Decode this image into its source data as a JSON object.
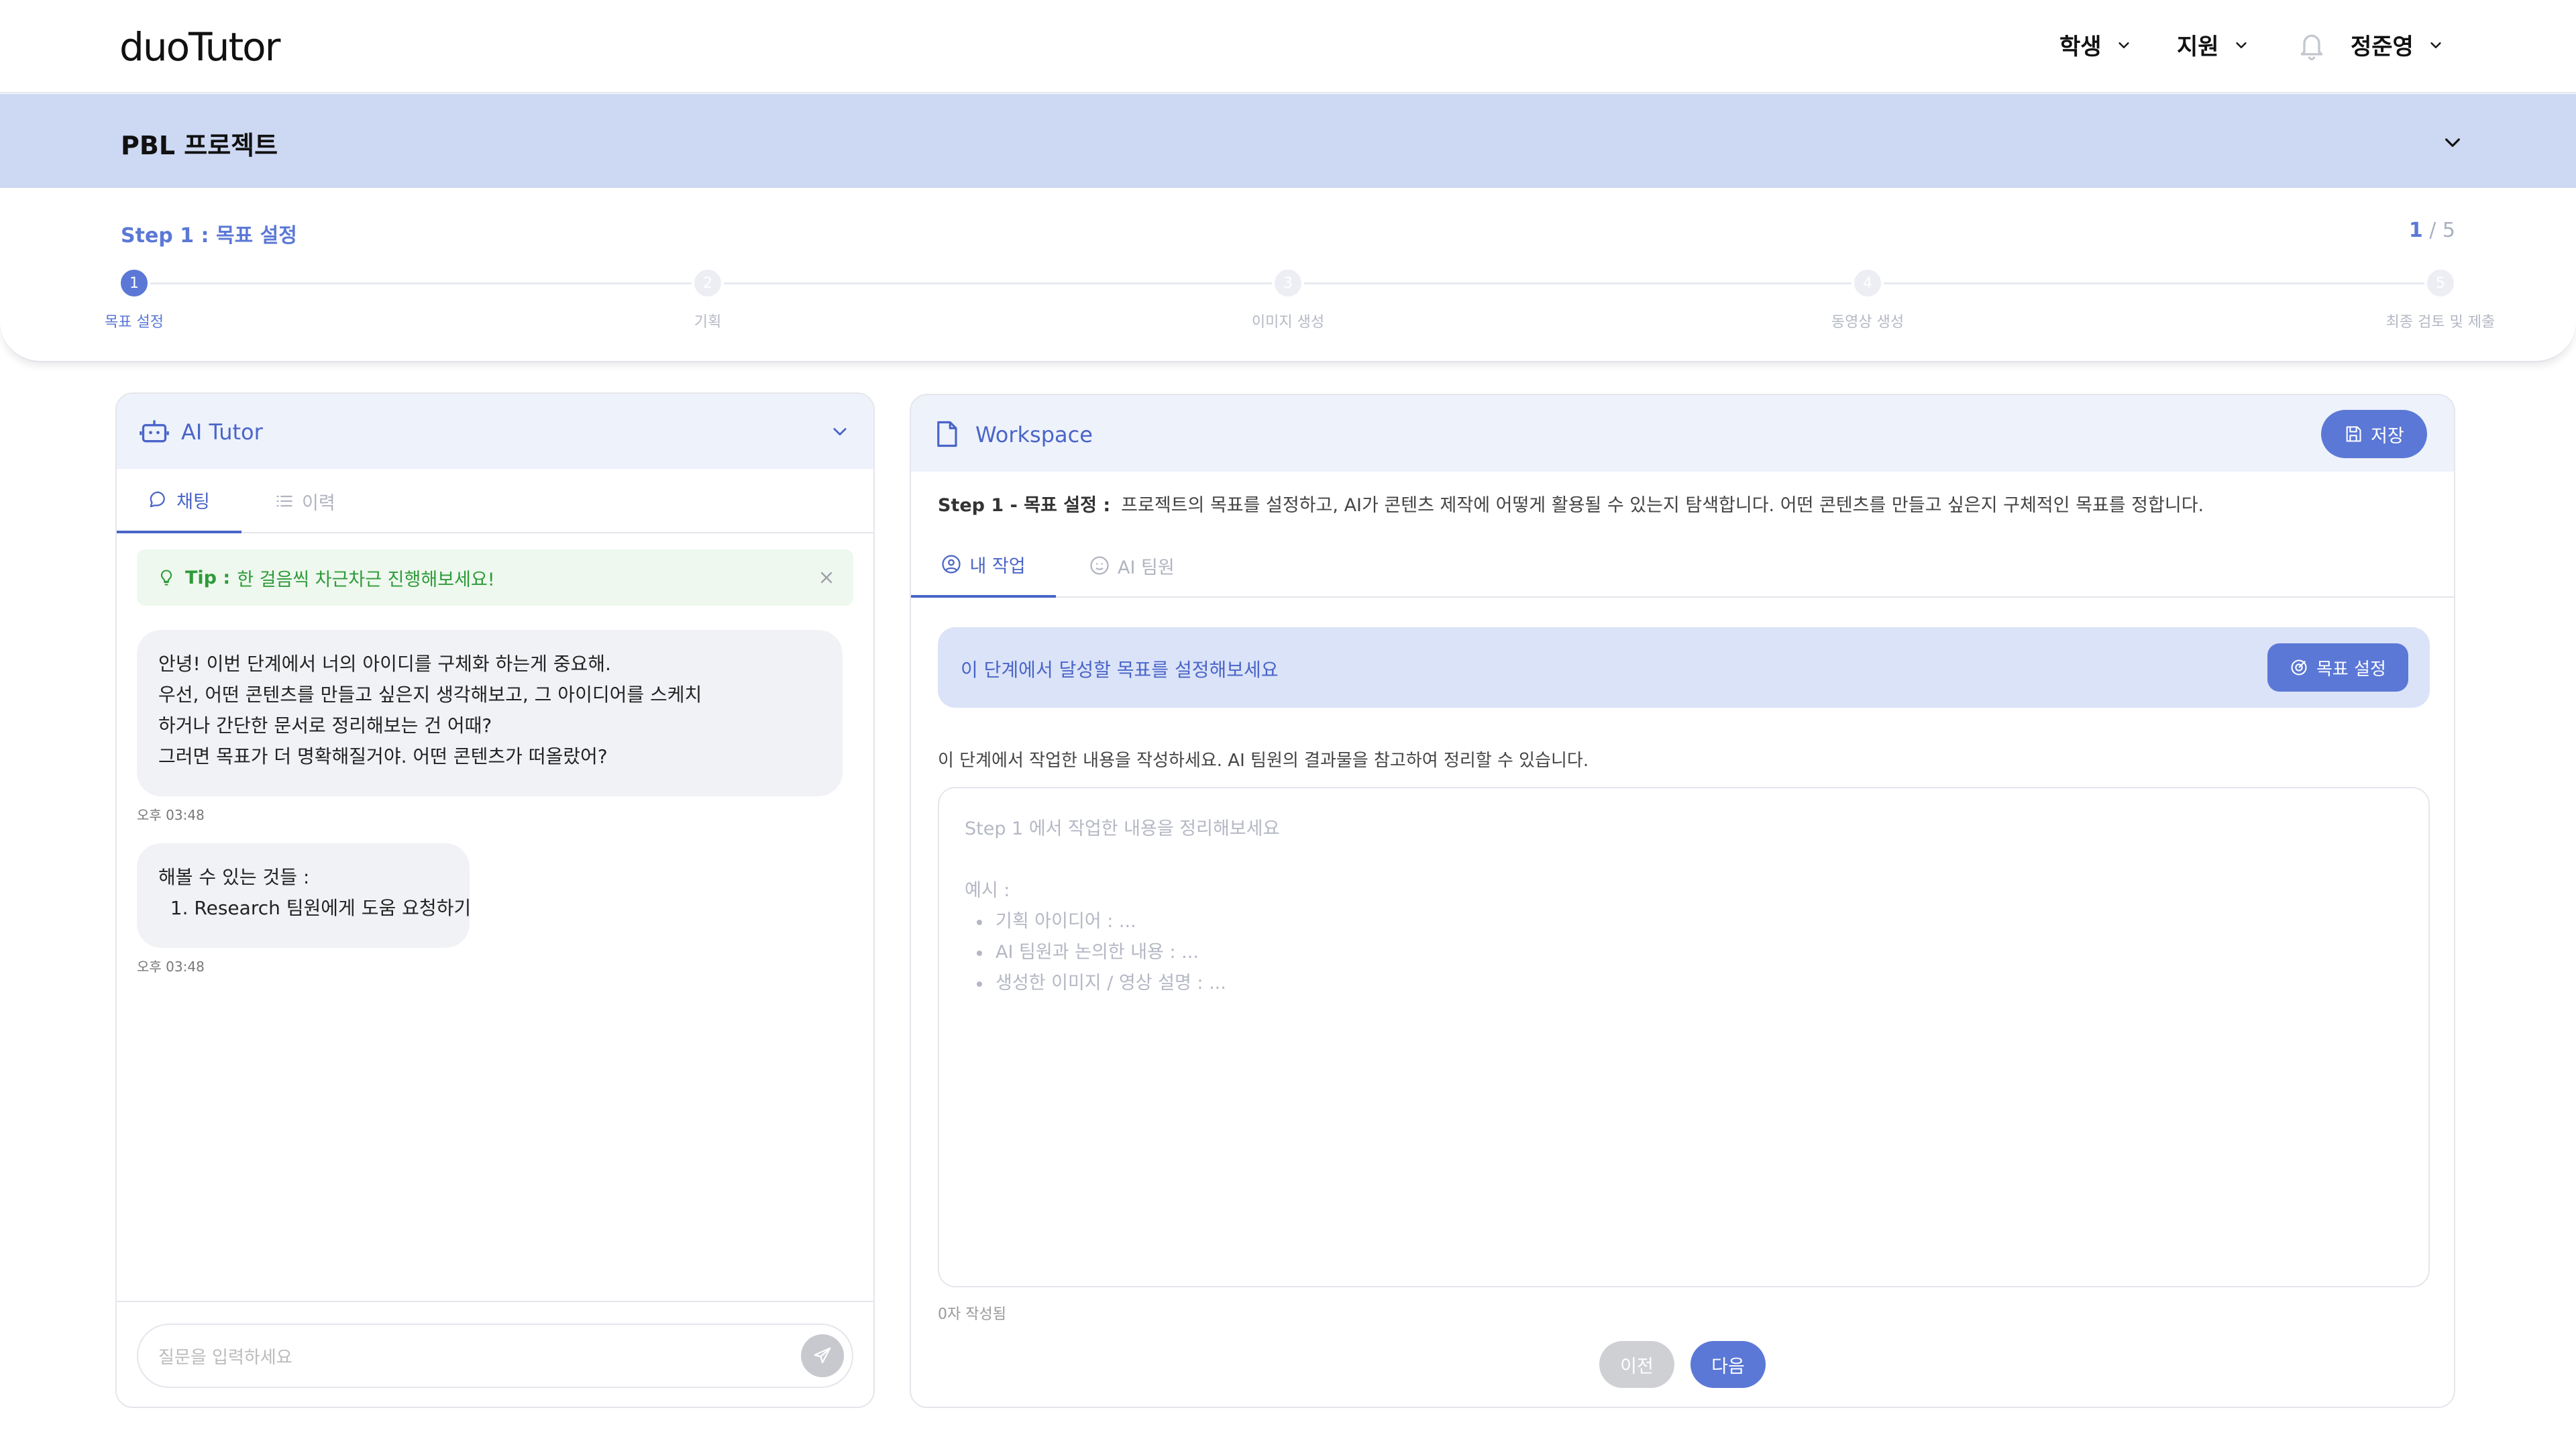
{
  "app": {
    "logo": "duoTutor"
  },
  "nav": {
    "student_label": "학생",
    "support_label": "지원",
    "user_name": "정준영"
  },
  "banner": {
    "title": "PBL 프로젝트"
  },
  "stepper": {
    "current_title": "Step 1 : 목표 설정",
    "current": "1",
    "separator": "/",
    "total": "5",
    "steps": [
      {
        "num": "1",
        "label": "목표 설정"
      },
      {
        "num": "2",
        "label": "기획"
      },
      {
        "num": "3",
        "label": "이미지 생성"
      },
      {
        "num": "4",
        "label": "동영상 생성"
      },
      {
        "num": "5",
        "label": "최종 검토 및 제출"
      }
    ]
  },
  "tutor": {
    "title": "AI Tutor",
    "tabs": [
      {
        "label": "채팅"
      },
      {
        "label": "이력"
      }
    ],
    "tip_label": "Tip :",
    "tip_text": "한 걸음씩 차근차근 진행해보세요!",
    "messages": [
      {
        "lines": [
          "안녕! 이번 단계에서 너의 아이디를 구체화 하는게 중요해.",
          "우선, 어떤 콘텐츠를 만들고 싶은지 생각해보고, 그 아이디어를 스케치",
          "하거나 간단한 문서로 정리해보는 건 어때?",
          "그러면 목표가 더 명확해질거야. 어떤 콘텐츠가 떠올랐어?"
        ],
        "time": "오후 03:48"
      },
      {
        "lines": [
          "해볼 수 있는 것들 :",
          "  1. Research 팀원에게 도움 요청하기"
        ],
        "time": "오후 03:48"
      }
    ],
    "input_placeholder": "질문을 입력하세요"
  },
  "workspace": {
    "title": "Workspace",
    "save_label": "저장",
    "desc_label": "Step 1 - 목표 설정 :",
    "desc_text": "프로젝트의 목표를 설정하고, AI가 콘텐츠 제작에 어떻게 활용될 수 있는지 탐색합니다. 어떤 콘텐츠를 만들고 싶은지 구체적인 목표를 정합니다.",
    "tabs": [
      {
        "label": "내 작업"
      },
      {
        "label": "AI 팀원"
      }
    ],
    "goal_prompt": "이 단계에서 달성할 목표를 설정해보세요",
    "goal_button": "목표 설정",
    "note": "이 단계에서 작업한 내용을 작성하세요. AI 팀원의 결과물을 참고하여 정리할 수 있습니다.",
    "textarea_placeholder": "Step 1 에서 작업한 내용을 정리해보세요",
    "example_label": "예시 :",
    "examples": [
      "기획 아이디어 : ...",
      "AI 팀원과 논의한 내용 : ...",
      "생성한 이미지 / 영상 설명 : ..."
    ],
    "char_count": "0자 작성됨",
    "prev_label": "이전",
    "next_label": "다음"
  },
  "colors": {
    "accent": "#5b78d6",
    "banner": "#cdd8f2",
    "panel_header": "#eef2fb",
    "tip_green": "#2f9a3a"
  }
}
